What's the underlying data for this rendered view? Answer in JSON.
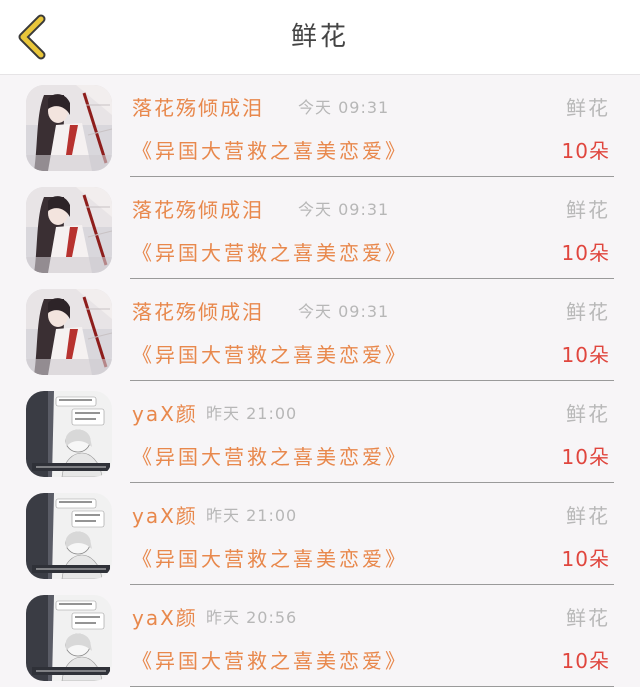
{
  "header": {
    "title": "鲜花",
    "back_icon": "chevron-left-icon",
    "accent": "#e9c63a"
  },
  "colors": {
    "name": "#e8884c",
    "amount": "#e0463e",
    "muted": "#b7b7b7"
  },
  "records": [
    {
      "user": "落花殇倾成泪",
      "time": "今天 09:31",
      "category": "鲜花",
      "book": "《异国大营救之喜美恋爱》",
      "amount": "10朵",
      "avatar": "anime-girl-avatar"
    },
    {
      "user": "落花殇倾成泪",
      "time": "今天 09:31",
      "category": "鲜花",
      "book": "《异国大营救之喜美恋爱》",
      "amount": "10朵",
      "avatar": "anime-girl-avatar"
    },
    {
      "user": "落花殇倾成泪",
      "time": "今天 09:31",
      "category": "鲜花",
      "book": "《异国大营救之喜美恋爱》",
      "amount": "10朵",
      "avatar": "anime-girl-avatar"
    },
    {
      "user": "yaX颜",
      "time": "昨天 21:00",
      "category": "鲜花",
      "book": "《异国大营救之喜美恋爱》",
      "amount": "10朵",
      "avatar": "comic-panel-avatar"
    },
    {
      "user": "yaX颜",
      "time": "昨天 21:00",
      "category": "鲜花",
      "book": "《异国大营救之喜美恋爱》",
      "amount": "10朵",
      "avatar": "comic-panel-avatar"
    },
    {
      "user": "yaX颜",
      "time": "昨天 20:56",
      "category": "鲜花",
      "book": "《异国大营救之喜美恋爱》",
      "amount": "10朵",
      "avatar": "comic-panel-avatar"
    }
  ]
}
